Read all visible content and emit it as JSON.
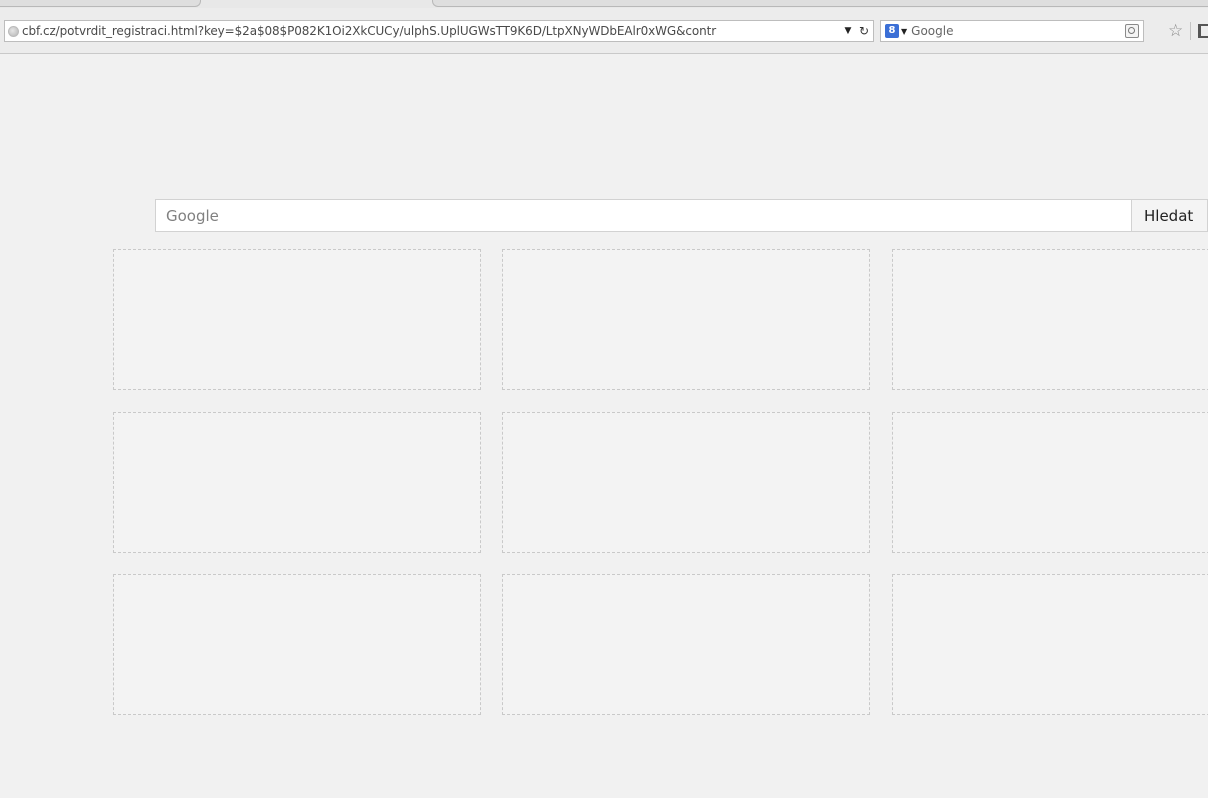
{
  "browser": {
    "url": "cbf.cz/potvrdit_registraci.html?key=$2a$08$P082K1Oi2XkCUCy/ulphS.UplUGWsTT9K6D/LtpXNyWDbEAlr0xWG&contr",
    "search_engine_placeholder": "Google",
    "search_engine_icon_letter": "8"
  },
  "newtab": {
    "search_placeholder": "Google",
    "search_button_label": "Hledat",
    "tile_count": 9
  }
}
